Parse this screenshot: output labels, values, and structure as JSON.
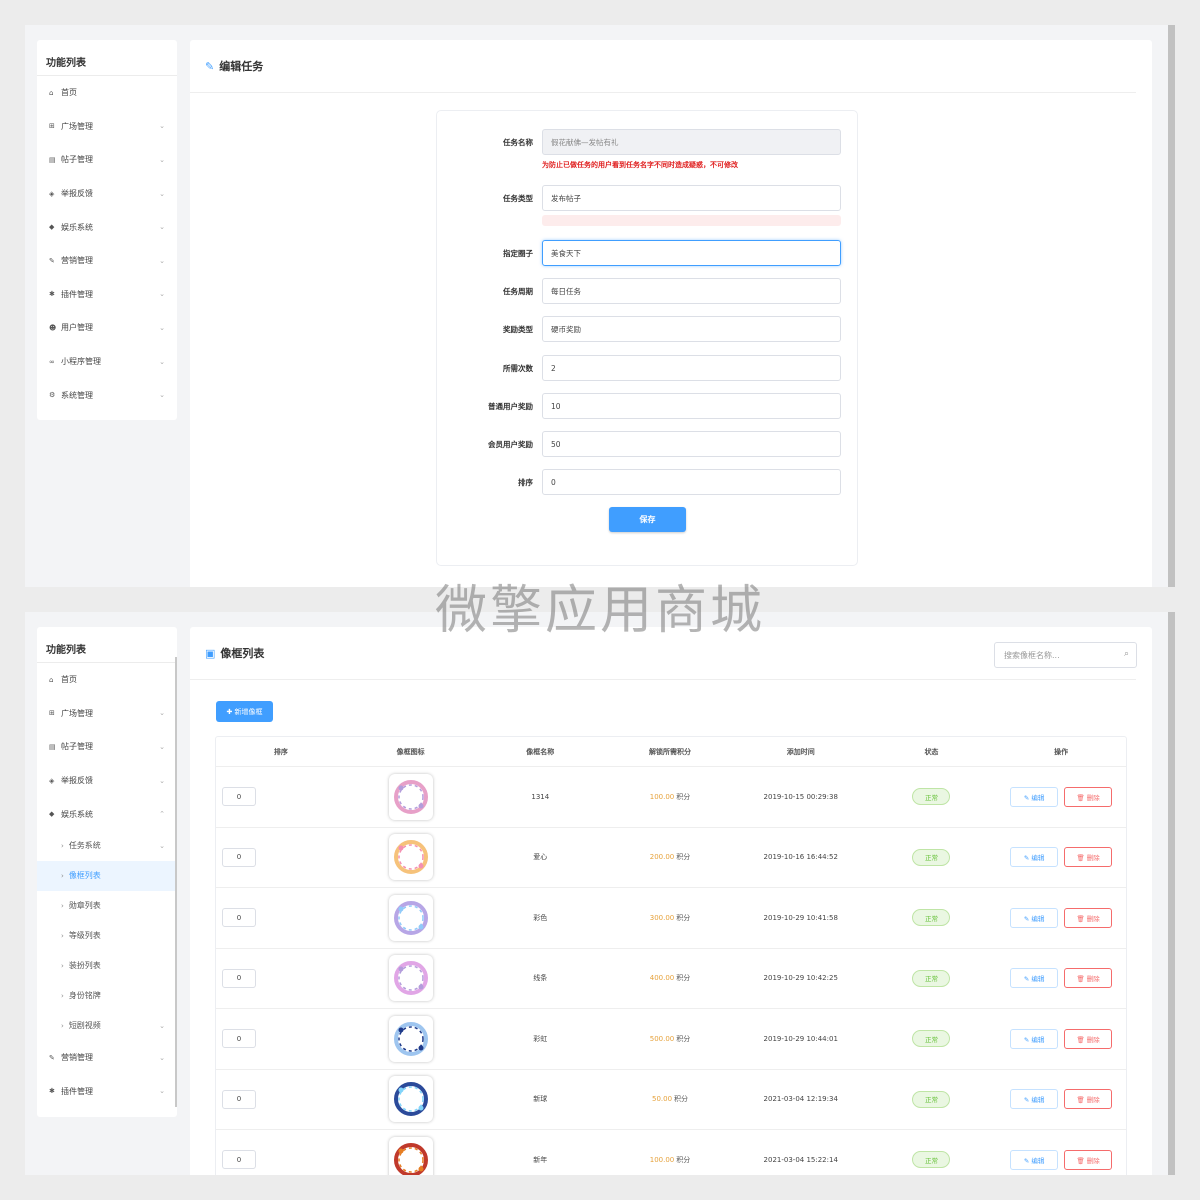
{
  "sidebar": {
    "title": "功能列表",
    "items": [
      {
        "label": "首页",
        "icon": "home-icon",
        "glyph": "⌂"
      },
      {
        "label": "广场管理",
        "icon": "square-icon",
        "glyph": "⊞"
      },
      {
        "label": "帖子管理",
        "icon": "document-icon",
        "glyph": "▤"
      },
      {
        "label": "举报反馈",
        "icon": "shield-icon",
        "glyph": "◈"
      },
      {
        "label": "娱乐系统",
        "icon": "tag-icon",
        "glyph": "◆"
      },
      {
        "label": "营销管理",
        "icon": "pen-icon",
        "glyph": "✎"
      },
      {
        "label": "插件管理",
        "icon": "puzzle-icon",
        "glyph": "✱"
      },
      {
        "label": "用户管理",
        "icon": "users-icon",
        "glyph": "☻"
      },
      {
        "label": "小程序管理",
        "icon": "network-icon",
        "glyph": "∞"
      },
      {
        "label": "系统管理",
        "icon": "gears-icon",
        "glyph": "⚙"
      }
    ],
    "sub_items": [
      "任务系统",
      "像框列表",
      "勋章列表",
      "等级列表",
      "装扮列表",
      "身份铭牌",
      "短剧视频"
    ]
  },
  "edit_task": {
    "title": "编辑任务",
    "fields": {
      "task_name": {
        "label": "任务名称",
        "value": "假花献佛—发帖有礼"
      },
      "warning": "为防止已做任务的用户看到任务名字不同时造成疑惑，不可修改",
      "task_type": {
        "label": "任务类型",
        "value": "发布帖子"
      },
      "circle": {
        "label": "指定圈子",
        "value": "美食天下"
      },
      "cycle": {
        "label": "任务周期",
        "value": "每日任务"
      },
      "reward_type": {
        "label": "奖励类型",
        "value": "硬币奖励"
      },
      "times": {
        "label": "所需次数",
        "value": "2"
      },
      "normal_reward": {
        "label": "普通用户奖励",
        "value": "10"
      },
      "vip_reward": {
        "label": "会员用户奖励",
        "value": "50"
      },
      "sort": {
        "label": "排序",
        "value": "0"
      }
    },
    "save_label": "保存"
  },
  "frame_list": {
    "title": "像框列表",
    "search_placeholder": "搜索像框名称...",
    "add_label": "✚ 新增像框",
    "columns": [
      "排序",
      "像框图标",
      "像框名称",
      "解锁所需积分",
      "添加时间",
      "状态",
      "操作"
    ],
    "points_unit": "积分",
    "status_label": "正常",
    "edit_label": "✎ 编辑",
    "delete_label": "🗑 删除",
    "rows": [
      {
        "sort": "0",
        "name": "1314",
        "points": "100.00",
        "time": "2019-10-15 00:29:38",
        "ring": "#e7a0c8",
        "accent": "#b39ddb"
      },
      {
        "sort": "0",
        "name": "爱心",
        "points": "200.00",
        "time": "2019-10-16 16:44:52",
        "ring": "#f6c27a",
        "accent": "#f48fb1"
      },
      {
        "sort": "0",
        "name": "彩色",
        "points": "300.00",
        "time": "2019-10-29 10:41:58",
        "ring": "#b7a6e6",
        "accent": "#90caf9"
      },
      {
        "sort": "0",
        "name": "线条",
        "points": "400.00",
        "time": "2019-10-29 10:42:25",
        "ring": "#e1a6e6",
        "accent": "#b39ddb"
      },
      {
        "sort": "0",
        "name": "彩虹",
        "points": "500.00",
        "time": "2019-10-29 10:44:01",
        "ring": "#9ec5ef",
        "accent": "#1e3a8a"
      },
      {
        "sort": "0",
        "name": "新球",
        "points": "50.00",
        "time": "2021-03-04 12:19:34",
        "ring": "#2b4a9a",
        "accent": "#81d4fa"
      },
      {
        "sort": "0",
        "name": "新年",
        "points": "100.00",
        "time": "2021-03-04 15:22:14",
        "ring": "#c0392b",
        "accent": "#e67e22"
      }
    ]
  },
  "watermark": "微擎应用商城"
}
